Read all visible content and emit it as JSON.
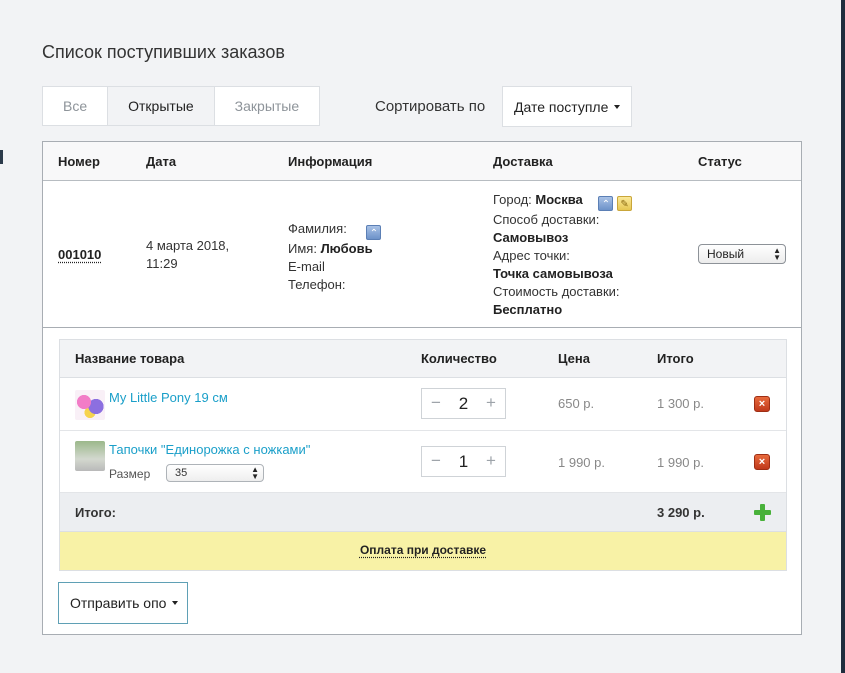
{
  "page": {
    "title": "Список поступивших заказов"
  },
  "tabs": [
    {
      "label": "Все",
      "active": false
    },
    {
      "label": "Открытые",
      "active": true
    },
    {
      "label": "Закрытые",
      "active": false
    }
  ],
  "sort": {
    "label": "Сортировать по",
    "value": "Дате поступле"
  },
  "table": {
    "headers": {
      "number": "Номер",
      "date": "Дата",
      "info": "Информация",
      "delivery": "Доставка",
      "status": "Статус"
    }
  },
  "order": {
    "number": "001010",
    "date": "4 марта 2018, 11:29",
    "info": {
      "surname_label": "Фамилия:",
      "surname": "",
      "name_label": "Имя:",
      "name": "Любовь",
      "email_label": "E-mail",
      "phone_label": "Телефон:"
    },
    "delivery": {
      "city_label": "Город:",
      "city": "Москва",
      "method_label": "Способ доставки:",
      "method": "Самовывоз",
      "address_label": "Адрес точки:",
      "address": "Точка самовывоза",
      "cost_label": "Стоимость доставки:",
      "cost": "Бесплатно"
    },
    "status": "Новый"
  },
  "items": {
    "headers": {
      "name": "Название товара",
      "qty": "Количество",
      "price": "Цена",
      "total": "Итого"
    },
    "rows": [
      {
        "name": "My Little Pony 19 см",
        "qty": "2",
        "price": "650 р.",
        "total": "1 300 р."
      },
      {
        "name": "Тапочки \"Единорожка с ножками\"",
        "size_label": "Размер",
        "size": "35",
        "qty": "1",
        "price": "1 990 р.",
        "total": "1 990 р."
      }
    ],
    "sum_label": "Итого:",
    "sum_value": "3 290 р.",
    "payment": "Оплата при доставке"
  },
  "actions": {
    "send_label": "Отправить опо"
  },
  "icons": {
    "minus": "−",
    "plus": "+",
    "delete": "×",
    "collapse": "⌃",
    "edit": "✎"
  },
  "colors": {
    "link": "#1a9fc9",
    "payment_bg": "#f8f2a6",
    "delete": "#c0391b",
    "add": "#48b13a"
  }
}
